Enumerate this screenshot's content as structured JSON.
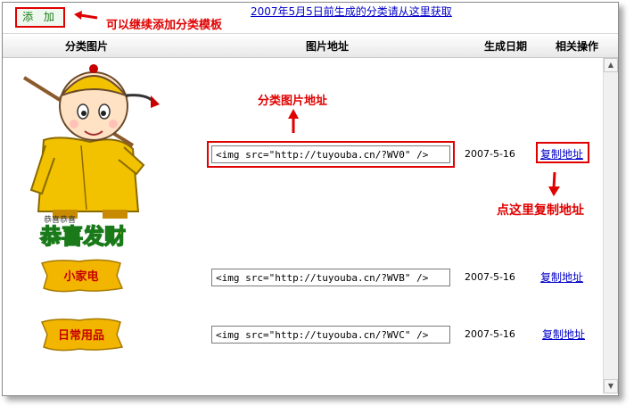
{
  "toolbar": {
    "add_label": "添 加",
    "add_hint": "可以继续添加分类模板",
    "archive_link": "2007年5月5日前生成的分类请从这里获取"
  },
  "header": {
    "col_image": "分类图片",
    "col_url": "图片地址",
    "col_date": "生成日期",
    "col_actions": "相关操作"
  },
  "annotations": {
    "image_url_hint": "分类图片地址",
    "copy_hint": "点这里复制地址"
  },
  "rows": [
    {
      "image_label": "恭喜发财",
      "image_caption": "恭喜恭喜",
      "url": "<img src=\"http://tuyouba.cn/?WV0\" />",
      "date": "2007-5-16",
      "copy_label": "复制地址"
    },
    {
      "image_label": "小家电",
      "url": "<img src=\"http://tuyouba.cn/?WVB\" />",
      "date": "2007-5-16",
      "copy_label": "复制地址"
    },
    {
      "image_label": "日常用品",
      "url": "<img src=\"http://tuyouba.cn/?WVC\" />",
      "date": "2007-5-16",
      "copy_label": "复制地址"
    }
  ],
  "colors": {
    "annotation_red": "#e00000",
    "link_blue": "#0000c8",
    "button_green": "#1a7a1a",
    "tag_gold": "#f2b500"
  }
}
